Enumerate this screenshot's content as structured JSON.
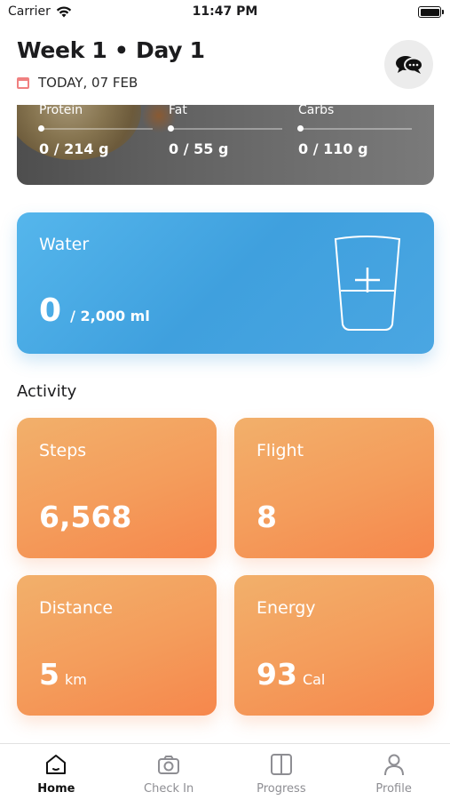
{
  "status_bar": {
    "carrier": "Carrier",
    "time": "11:47 PM"
  },
  "header": {
    "title": "Week 1 • Day 1",
    "date": "TODAY, 07 FEB"
  },
  "macros": [
    {
      "label": "Protein",
      "value": "0 / 214 g",
      "progress": 0
    },
    {
      "label": "Fat",
      "value": "0 / 55 g",
      "progress": 0
    },
    {
      "label": "Carbs",
      "value": "0 / 110 g",
      "progress": 0
    }
  ],
  "water": {
    "label": "Water",
    "amount": "0",
    "goal": "/ 2,000 ml"
  },
  "activity": {
    "title": "Activity",
    "steps": {
      "label": "Steps",
      "value": "6,568",
      "unit": ""
    },
    "flight": {
      "label": "Flight",
      "value": "8",
      "unit": ""
    },
    "distance": {
      "label": "Distance",
      "value": "5",
      "unit": "km"
    },
    "energy": {
      "label": "Energy",
      "value": "93",
      "unit": "Cal"
    }
  },
  "tabs": [
    {
      "label": "Home",
      "icon": "home-icon",
      "active": true
    },
    {
      "label": "Check In",
      "icon": "camera-icon",
      "active": false
    },
    {
      "label": "Progress",
      "icon": "progress-icon",
      "active": false
    },
    {
      "label": "Profile",
      "icon": "person-icon",
      "active": false
    }
  ],
  "colors": {
    "water": "#42a2e0",
    "activity": "#f49c5b",
    "calendar": "#f08080"
  }
}
